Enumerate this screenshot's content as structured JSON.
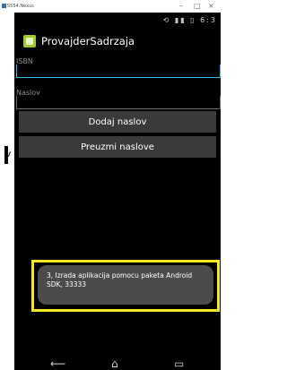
{
  "window": {
    "title": "5554:Nexus",
    "controls": [
      "–",
      "□",
      "×"
    ]
  },
  "status_bar": {
    "icons": [
      "sync-icon",
      "signal-icon",
      "battery-icon"
    ],
    "clock": "6:3"
  },
  "action_bar": {
    "app_icon": "android-app-icon",
    "title": "ProvajderSadrzaja"
  },
  "form": {
    "isbn_label": "ISBN",
    "isbn_value": "",
    "naslov_label": "Naslov",
    "naslov_value": ""
  },
  "buttons": {
    "add_label": "Dodaj naslov",
    "fetch_label": "Preuzmi naslove"
  },
  "toast": {
    "text": "3, Izrada aplikacija pomocu paketa Android SDK, 33333",
    "highlight_color": "#f2ea1c"
  },
  "nav_bar": {
    "icons": [
      "back-icon",
      "home-icon",
      "recent-apps-icon"
    ]
  },
  "colors": {
    "accent": "#33b5e5",
    "background": "#000000",
    "button": "#3a3a3a"
  }
}
